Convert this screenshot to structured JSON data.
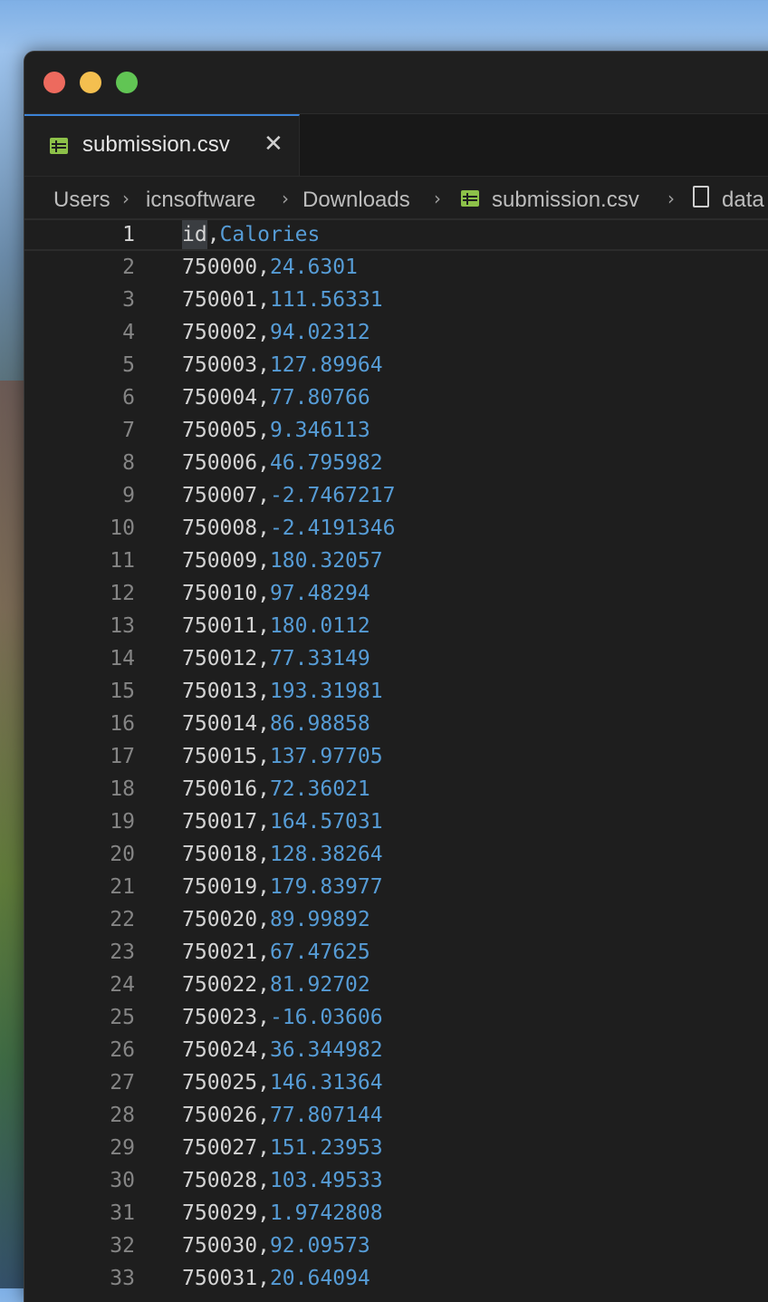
{
  "window": {
    "tab": {
      "filename": "submission.csv",
      "close_glyph": "✕",
      "icon": "table-icon"
    },
    "breadcrumb": {
      "items": [
        "Users",
        "icnsoftware",
        "Downloads",
        "submission.csv",
        "data"
      ],
      "separator": "›"
    }
  },
  "editor": {
    "language": "csv",
    "colors": {
      "column1": "#d4d4d4",
      "column2": "#569cd6",
      "line_number": "#858585",
      "accent": "#3b82d6"
    },
    "lines": [
      {
        "n": "1",
        "c1": "id",
        "sep": ",",
        "c2": "Calories"
      },
      {
        "n": "2",
        "c1": "750000",
        "sep": ",",
        "c2": "24.6301"
      },
      {
        "n": "3",
        "c1": "750001",
        "sep": ",",
        "c2": "111.56331"
      },
      {
        "n": "4",
        "c1": "750002",
        "sep": ",",
        "c2": "94.02312"
      },
      {
        "n": "5",
        "c1": "750003",
        "sep": ",",
        "c2": "127.89964"
      },
      {
        "n": "6",
        "c1": "750004",
        "sep": ",",
        "c2": "77.80766"
      },
      {
        "n": "7",
        "c1": "750005",
        "sep": ",",
        "c2": "9.346113"
      },
      {
        "n": "8",
        "c1": "750006",
        "sep": ",",
        "c2": "46.795982"
      },
      {
        "n": "9",
        "c1": "750007",
        "sep": ",",
        "c2": "-2.7467217"
      },
      {
        "n": "10",
        "c1": "750008",
        "sep": ",",
        "c2": "-2.4191346"
      },
      {
        "n": "11",
        "c1": "750009",
        "sep": ",",
        "c2": "180.32057"
      },
      {
        "n": "12",
        "c1": "750010",
        "sep": ",",
        "c2": "97.48294"
      },
      {
        "n": "13",
        "c1": "750011",
        "sep": ",",
        "c2": "180.0112"
      },
      {
        "n": "14",
        "c1": "750012",
        "sep": ",",
        "c2": "77.33149"
      },
      {
        "n": "15",
        "c1": "750013",
        "sep": ",",
        "c2": "193.31981"
      },
      {
        "n": "16",
        "c1": "750014",
        "sep": ",",
        "c2": "86.98858"
      },
      {
        "n": "17",
        "c1": "750015",
        "sep": ",",
        "c2": "137.97705"
      },
      {
        "n": "18",
        "c1": "750016",
        "sep": ",",
        "c2": "72.36021"
      },
      {
        "n": "19",
        "c1": "750017",
        "sep": ",",
        "c2": "164.57031"
      },
      {
        "n": "20",
        "c1": "750018",
        "sep": ",",
        "c2": "128.38264"
      },
      {
        "n": "21",
        "c1": "750019",
        "sep": ",",
        "c2": "179.83977"
      },
      {
        "n": "22",
        "c1": "750020",
        "sep": ",",
        "c2": "89.99892"
      },
      {
        "n": "23",
        "c1": "750021",
        "sep": ",",
        "c2": "67.47625"
      },
      {
        "n": "24",
        "c1": "750022",
        "sep": ",",
        "c2": "81.92702"
      },
      {
        "n": "25",
        "c1": "750023",
        "sep": ",",
        "c2": "-16.03606"
      },
      {
        "n": "26",
        "c1": "750024",
        "sep": ",",
        "c2": "36.344982"
      },
      {
        "n": "27",
        "c1": "750025",
        "sep": ",",
        "c2": "146.31364"
      },
      {
        "n": "28",
        "c1": "750026",
        "sep": ",",
        "c2": "77.807144"
      },
      {
        "n": "29",
        "c1": "750027",
        "sep": ",",
        "c2": "151.23953"
      },
      {
        "n": "30",
        "c1": "750028",
        "sep": ",",
        "c2": "103.49533"
      },
      {
        "n": "31",
        "c1": "750029",
        "sep": ",",
        "c2": "1.9742808"
      },
      {
        "n": "32",
        "c1": "750030",
        "sep": ",",
        "c2": "92.09573"
      },
      {
        "n": "33",
        "c1": "750031",
        "sep": ",",
        "c2": "20.64094"
      }
    ]
  }
}
